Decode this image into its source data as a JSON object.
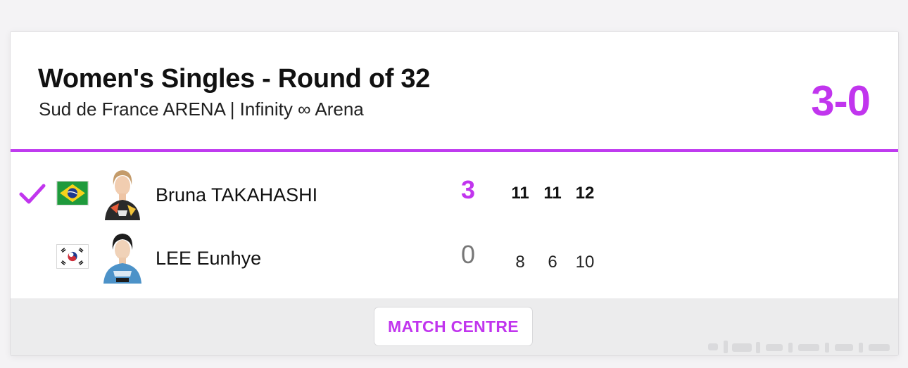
{
  "match": {
    "title": "Women's Singles - Round of 32",
    "venue": "Sud de France ARENA | Infinity ∞ Arena",
    "score": "3-0"
  },
  "players": [
    {
      "name": "Bruna TAKAHASHI",
      "country_flag": "brazil-flag",
      "winner": true,
      "sets_won": "3",
      "games": [
        "11",
        "11",
        "12"
      ]
    },
    {
      "name": "LEE Eunhye",
      "country_flag": "korea-flag",
      "winner": false,
      "sets_won": "0",
      "games": [
        "8",
        "6",
        "10"
      ]
    }
  ],
  "footer": {
    "button_label": "MATCH CENTRE"
  },
  "colors": {
    "accent": "#c135ee",
    "divider": "#bf3bef",
    "footer_bg": "#ececed"
  }
}
